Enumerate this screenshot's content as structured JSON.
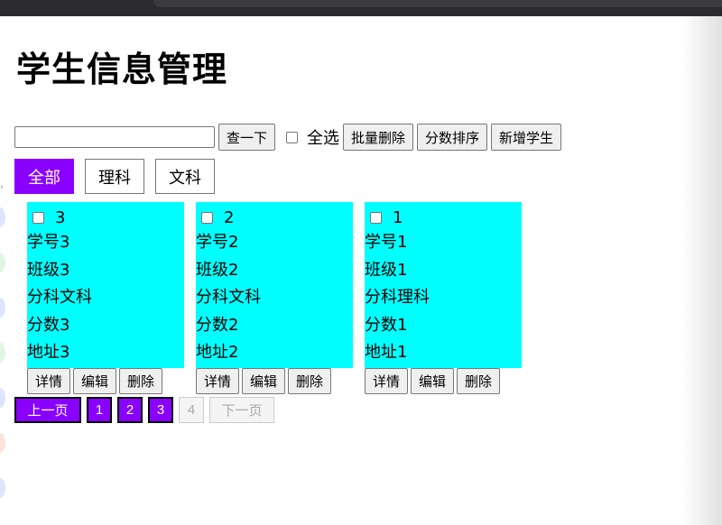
{
  "title": "学生信息管理",
  "toolbar": {
    "search_value": "",
    "search_button": "查一下",
    "select_all_label": "全选",
    "batch_delete": "批量删除",
    "sort_by_score": "分数排序",
    "add_student": "新增学生"
  },
  "filters": {
    "all": "全部",
    "science": "理科",
    "arts": "文科",
    "active": "all"
  },
  "students": [
    {
      "id": "3",
      "student_no": "学号3",
      "class": "班级3",
      "track": "分科文科",
      "score": "分数3",
      "address": "地址3"
    },
    {
      "id": "2",
      "student_no": "学号2",
      "class": "班级2",
      "track": "分科文科",
      "score": "分数2",
      "address": "地址2"
    },
    {
      "id": "1",
      "student_no": "学号1",
      "class": "班级1",
      "track": "分科理科",
      "score": "分数1",
      "address": "地址1"
    }
  ],
  "card_actions": {
    "details": "详情",
    "edit": "编辑",
    "delete": "删除"
  },
  "pager": {
    "prev": "上一页",
    "pages": [
      "1",
      "2",
      "3",
      "4"
    ],
    "next": "下一页"
  },
  "colors": {
    "accent": "#8a00ff",
    "card_bg": "#00ffff"
  }
}
